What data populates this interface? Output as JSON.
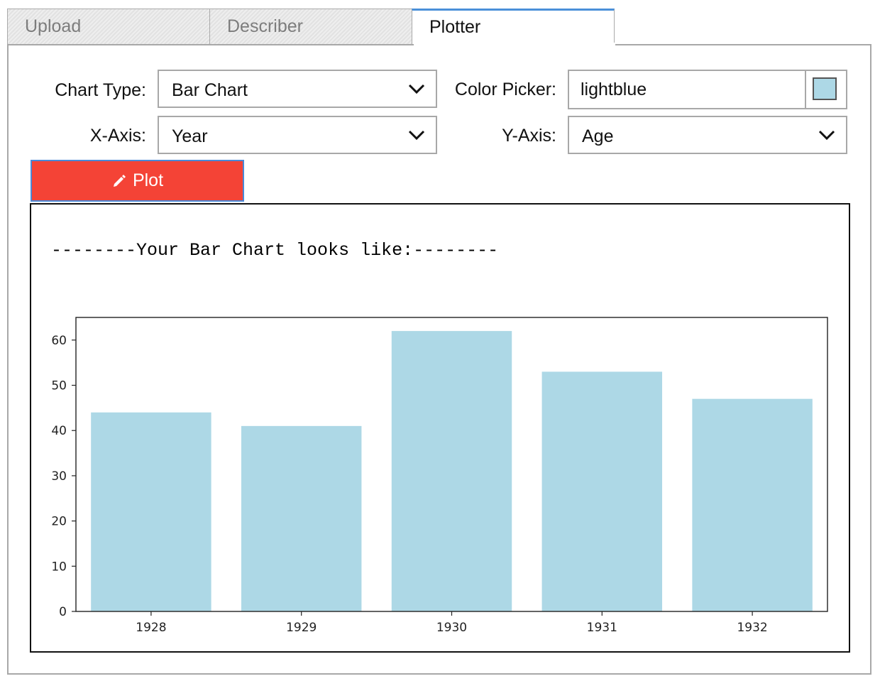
{
  "tabs": [
    {
      "label": "Upload",
      "active": false
    },
    {
      "label": "Describer",
      "active": false
    },
    {
      "label": "Plotter",
      "active": true
    }
  ],
  "form": {
    "chart_type_label": "Chart Type:",
    "chart_type_value": "Bar Chart",
    "x_axis_label": "X-Axis:",
    "x_axis_value": "Year",
    "color_picker_label": "Color Picker:",
    "color_picker_value": "lightblue",
    "color_swatch": "#add8e6",
    "y_axis_label": "Y-Axis:",
    "y_axis_value": "Age"
  },
  "plot_button": {
    "label": "Plot",
    "icon": "pencil-icon",
    "color": "#f44336"
  },
  "output": {
    "heading": "--------Your Bar Chart looks like:--------"
  },
  "chart_data": {
    "type": "bar",
    "categories": [
      "1928",
      "1929",
      "1930",
      "1931",
      "1932"
    ],
    "values": [
      44,
      41,
      62,
      53,
      47
    ],
    "ylim": [
      0,
      65
    ],
    "yticks": [
      0,
      10,
      20,
      30,
      40,
      50,
      60
    ],
    "bar_color": "#add8e6",
    "grid": false,
    "title": "",
    "xlabel": "",
    "ylabel": ""
  }
}
